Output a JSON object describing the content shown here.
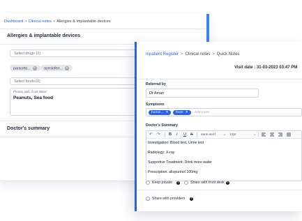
{
  "back": {
    "breadcrumb": {
      "dashboard": "Dashboard",
      "clinical_notes": "Clinical notes",
      "current": "Allergies & implantable devices",
      "sep": ">"
    },
    "section_title": "Allergies & implantable devices",
    "drugs_field": "Select drugs (2)",
    "drug_chips": [
      "paraceta...",
      "acecloferr..."
    ],
    "foods_field": "Select foods (0)",
    "notes_label": "Please add, if not listed",
    "notes_value": "Peanuts, Sea food",
    "doctor_summary": "Doctor's summary"
  },
  "front": {
    "breadcrumb": {
      "register": "Inpatient Register",
      "clinical_notes": "Clinical notes",
      "quick_notes": "Quick Notes",
      "sep": ">"
    },
    "visit_date": "Visit date : 31-03-2023 03:47 PM",
    "referred_label": "Referred by",
    "referred_value": "Dr Aman",
    "symptoms_label": "Symptoms",
    "symptom_chips": [
      "burnin...",
      "fever"
    ],
    "add_more": "Add more",
    "summary_label": "Doctor's Summary",
    "toolbar": {
      "undo": "↶",
      "redo": "↷",
      "bold": "B",
      "italic": "I",
      "underline": "U",
      "strike": "S",
      "font": "sans-serif",
      "size": "12pt",
      "chevron": "⌄"
    },
    "summary_lines": [
      "Investigation: Blood test, Urine test",
      "Radiology: X-ray",
      "Supportive Treatment: Drink more water",
      "Prescription: allopurinol 100mg"
    ],
    "keep_private": "Keep private",
    "share_front_desk": "Share with front desk",
    "share_providers": "Share with providers",
    "info_glyph": "?"
  },
  "colors": {
    "accent": "#2563eb",
    "chip_gray": "#e5e7eb",
    "border": "#cfd6df"
  }
}
